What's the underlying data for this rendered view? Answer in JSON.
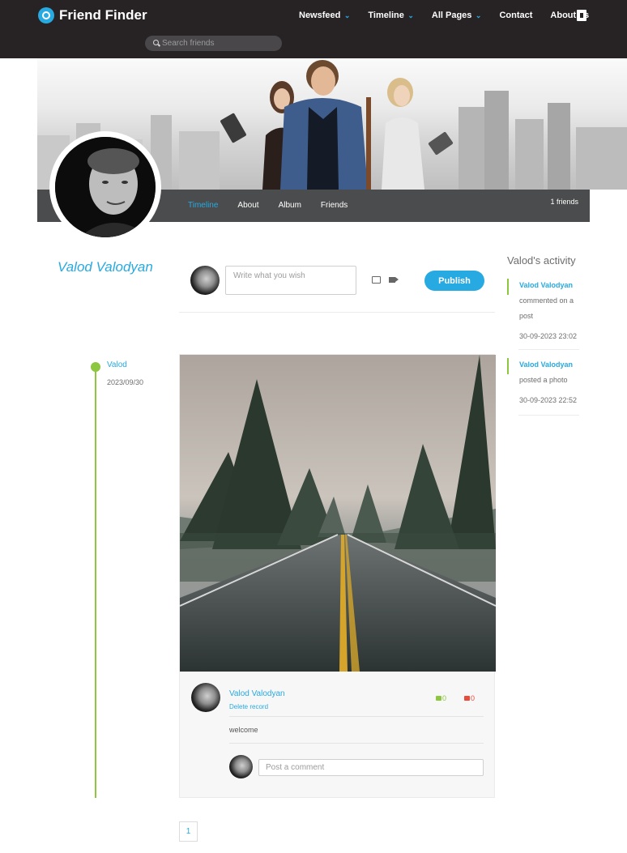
{
  "brand": {
    "name": "Friend Finder",
    "accent": "#27aae1",
    "green": "#8dc63f"
  },
  "nav": {
    "items": [
      {
        "label": "Newsfeed",
        "dropdown": true
      },
      {
        "label": "Timeline",
        "dropdown": true
      },
      {
        "label": "All Pages",
        "dropdown": true
      },
      {
        "label": "Contact",
        "dropdown": false
      },
      {
        "label": "About us",
        "dropdown": false
      }
    ],
    "logout_icon": "logout-icon"
  },
  "search": {
    "placeholder": "Search friends",
    "value": ""
  },
  "profile": {
    "name": "Valod Valodyan",
    "tabs": [
      "Timeline",
      "About",
      "Album",
      "Friends"
    ],
    "active_tab": "Timeline",
    "friends_count": "1 friends"
  },
  "composer": {
    "placeholder": "Write what you wish",
    "publish_label": "Publish"
  },
  "timeline": {
    "user": "Valod",
    "date": "2023/09/30"
  },
  "post": {
    "author": "Valod Valodyan",
    "delete_label": "Delete record",
    "likes": "0",
    "dislikes": "0",
    "text": "welcome",
    "comment_placeholder": "Post a comment"
  },
  "activity": {
    "title": "Valod's activity",
    "items": [
      {
        "who": "Valod Valodyan",
        "what": "commented on a post",
        "time": "30-09-2023 23:02"
      },
      {
        "who": "Valod Valodyan",
        "what": "posted a photo",
        "time": "30-09-2023 22:52"
      }
    ]
  },
  "pagination": {
    "pages": [
      "1"
    ]
  }
}
